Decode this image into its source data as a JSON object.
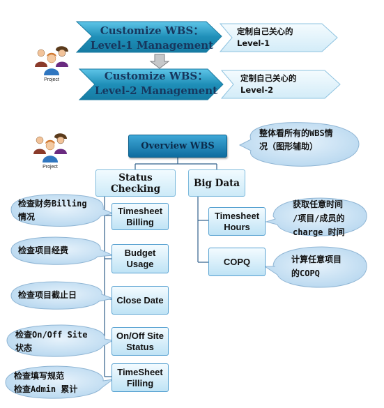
{
  "top": {
    "row1": {
      "chevron_line1": "Customize WBS：",
      "chevron_line2": "Level-1 Management",
      "note_line1": "定制自己关心的",
      "note_line2": "Level-1"
    },
    "row2": {
      "chevron_line1": "Customize WBS：",
      "chevron_line2": "Level-2 Management",
      "note_line1": "定制自己关心的",
      "note_line2": "Level-2"
    },
    "person_label": "Project"
  },
  "tree": {
    "person_label": "Project",
    "root": "Overview WBS",
    "root_note_line1": "整体看所有的WBS情",
    "root_note_line2": "况（图形辅助）",
    "branches": [
      {
        "label_line1": "Status",
        "label_line2": "Checking"
      },
      {
        "label_line1": "Big Data",
        "label_line2": ""
      }
    ],
    "status_items": [
      {
        "line1": "Timesheet",
        "line2": "Billing",
        "note_line1": "检查财务Billing",
        "note_line2": "情况"
      },
      {
        "line1": "Budget",
        "line2": "Usage",
        "note_line1": "检查项目经费",
        "note_line2": ""
      },
      {
        "line1": "Close Date",
        "line2": "",
        "note_line1": "检查项目截止日",
        "note_line2": ""
      },
      {
        "line1": "On/Off Site",
        "line2": "Status",
        "note_line1": "检查On/Off Site",
        "note_line2": "状态"
      },
      {
        "line1": "TimeSheet",
        "line2": "Filling",
        "note_line1": "检查填写规范",
        "note_line2": "检查Admin 累计"
      }
    ],
    "bigdata_items": [
      {
        "line1": "Timesheet",
        "line2": "Hours",
        "note_line1": "获取任意时间",
        "note_line2": "/项目/成员的",
        "note_line3": "charge 时间"
      },
      {
        "line1": "COPQ",
        "line2": "",
        "note_line1": "计算任意项目",
        "note_line2": "的COPQ",
        "note_line3": ""
      }
    ]
  },
  "colors": {
    "chevron_dark": "#1f8fb8",
    "chevron_light": "#dff1fa",
    "callout_fill": "#cfe6f7",
    "box_border": "#3d7fb2"
  }
}
